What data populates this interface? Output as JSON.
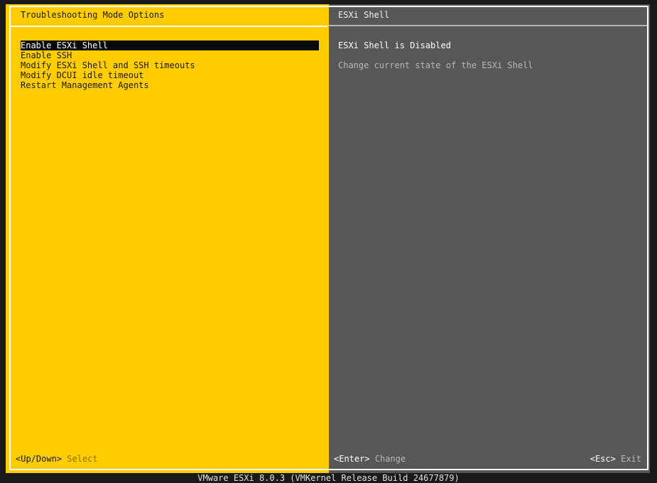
{
  "left_panel": {
    "title": "Troubleshooting Mode Options",
    "menu_items": [
      {
        "label": "Enable ESXi Shell",
        "selected": true
      },
      {
        "label": "Enable SSH",
        "selected": false
      },
      {
        "label": "Modify ESXi Shell and SSH timeouts",
        "selected": false
      },
      {
        "label": "Modify DCUI idle timeout",
        "selected": false
      },
      {
        "label": "Restart Management Agents",
        "selected": false
      }
    ]
  },
  "right_panel": {
    "title": "ESXi Shell",
    "status": "ESXi Shell is Disabled",
    "description": "Change current state of the ESXi Shell"
  },
  "hints": {
    "updown": {
      "key": "<Up/Down>",
      "action": "Select"
    },
    "enter": {
      "key": "<Enter>",
      "action": "Change"
    },
    "esc": {
      "key": "<Esc>",
      "action": "Exit"
    }
  },
  "footer": "VMware ESXi 8.0.3 (VMKernel Release Build 24677879)",
  "colors": {
    "left_background": "#ffcc00",
    "right_background": "#575757",
    "screen_background": "#1a1a1a",
    "selection_background": "#0a0a0a"
  }
}
